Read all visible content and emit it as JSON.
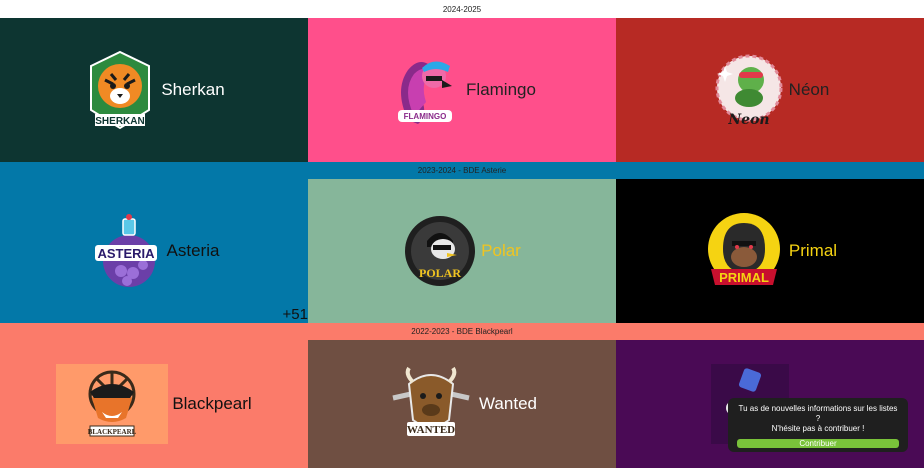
{
  "years": [
    {
      "label": "2024-2025",
      "lists": [
        {
          "name": "Sherkan",
          "bg": "#0d3531",
          "text_color": "#ffffff",
          "logo": "tiger-logo-icon"
        },
        {
          "name": "Flamingo",
          "bg": "#ff4f8b",
          "text_color": "#222222",
          "logo": "flamingo-logo-icon"
        },
        {
          "name": "Néon",
          "bg": "#b72a24",
          "text_color": "#222222",
          "logo": "turtle-logo-icon"
        }
      ]
    },
    {
      "label": "2023-2024 - BDE Asterie",
      "header_bg": "#0378a8",
      "lists": [
        {
          "name": "Asteria",
          "bg": "#0378a8",
          "text_color": "#111111",
          "logo": "potion-logo-icon"
        },
        {
          "name": "Polar",
          "bg": "#86b69a",
          "text_color": "#f0c420",
          "logo": "penguin-logo-icon"
        },
        {
          "name": "Primal",
          "bg": "#000000",
          "text_color": "#f5d312",
          "logo": "gorilla-logo-icon"
        }
      ],
      "more_label": "+51"
    },
    {
      "label": "2022-2023 - BDE Blackpearl",
      "header_bg": "#fb7b6a",
      "lists": [
        {
          "name": "Blackpearl",
          "bg": "#fb7b6a",
          "text_color": "#111111",
          "logo": "fox-pirate-logo-icon"
        },
        {
          "name": "Wanted",
          "bg": "#6f4f42",
          "text_color": "#ffffff",
          "logo": "bison-logo-icon"
        },
        {
          "name": "",
          "bg": "#4a0a55",
          "text_color": "#ffffff",
          "logo": "bottle-logo-icon"
        }
      ]
    }
  ],
  "toast": {
    "message_line1": "Tu as de nouvelles informations sur les listes ?",
    "message_line2": "N'hésite pas à contribuer !",
    "button_label": "Contribuer"
  }
}
